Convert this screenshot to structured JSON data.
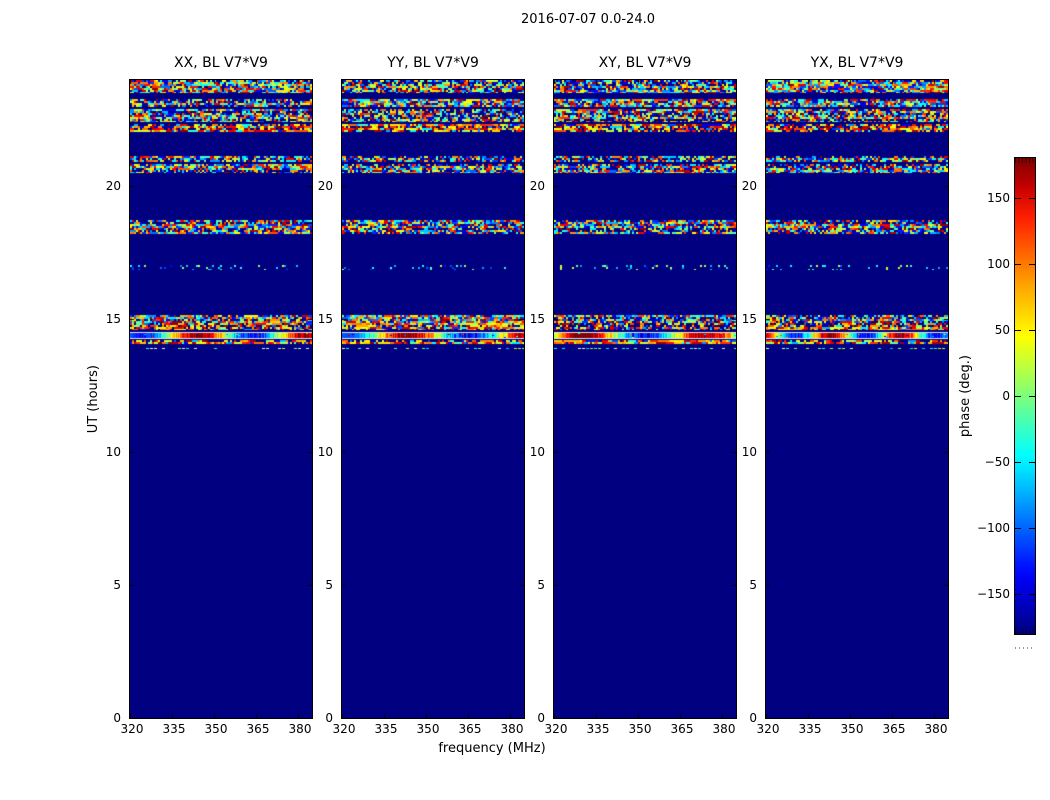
{
  "figure": {
    "title": "2016-07-07 0.0-24.0"
  },
  "chart_data": {
    "type": "heatmap",
    "title": "2016-07-07 0.0-24.0",
    "xlabel": "frequency (MHz)",
    "ylabel": "UT (hours)",
    "xlim": [
      320,
      385
    ],
    "ylim": [
      0,
      24
    ],
    "xticks": [
      320,
      335,
      350,
      365,
      380
    ],
    "yticks": [
      0,
      5,
      10,
      15,
      20
    ],
    "colormap": "jet",
    "background_phase_deg": -180,
    "panels": [
      {
        "label": "XX, BL V7*V9",
        "seed": 101
      },
      {
        "label": "YY, BL V7*V9",
        "seed": 202
      },
      {
        "label": "XY, BL V7*V9",
        "seed": 303
      },
      {
        "label": "YX, BL V7*V9",
        "seed": 404
      }
    ],
    "bands": [
      {
        "ut_from": 23.5,
        "ut_to": 24.0,
        "style": "noise",
        "density": 0.92,
        "note": "thick random-phase band at top"
      },
      {
        "ut_from": 23.0,
        "ut_to": 23.3,
        "style": "noise",
        "density": 0.85,
        "note": "random-phase stripe"
      },
      {
        "ut_from": 22.68,
        "ut_to": 22.9,
        "style": "noise",
        "density": 0.85,
        "note": "random-phase stripe"
      },
      {
        "ut_from": 22.42,
        "ut_to": 22.68,
        "style": "noise",
        "density": 0.8,
        "note": "random-phase stripe"
      },
      {
        "ut_from": 22.04,
        "ut_to": 22.34,
        "style": "noise-warm",
        "density": 0.85,
        "note": "stripe with red/orange excess"
      },
      {
        "ut_from": 20.91,
        "ut_to": 21.14,
        "style": "noise",
        "density": 0.7,
        "note": "thin stripe"
      },
      {
        "ut_from": 20.5,
        "ut_to": 20.84,
        "style": "noise",
        "density": 0.8,
        "note": "double stripe"
      },
      {
        "ut_from": 18.21,
        "ut_to": 18.73,
        "style": "noise",
        "density": 0.9,
        "note": "thick stripe near 18.4h"
      },
      {
        "ut_from": 16.85,
        "ut_to": 17.04,
        "style": "sparse",
        "density": 0.12,
        "note": "very faint sparse stripe"
      },
      {
        "ut_from": 14.86,
        "ut_to": 15.16,
        "style": "noise",
        "density": 0.88,
        "note": "stripe at 15h"
      },
      {
        "ut_from": 14.6,
        "ut_to": 14.86,
        "style": "noise-warm",
        "density": 0.85,
        "note": "stripe with warm streaks"
      },
      {
        "ut_from": 14.26,
        "ut_to": 14.52,
        "style": "smooth",
        "density": 1.0,
        "note": "smooth coherent phase gradient band with pale edges"
      },
      {
        "ut_from": 14.07,
        "ut_to": 14.22,
        "style": "noise-warm",
        "density": 0.85,
        "note": "thin warm stripe"
      },
      {
        "ut_from": 13.84,
        "ut_to": 13.96,
        "style": "dotted",
        "density": 0.3,
        "note": "sparse dashed cyan/white line"
      }
    ],
    "colorbar": {
      "label": "phase (deg.)",
      "range": [
        -180,
        180
      ],
      "ticks": [
        -150,
        -100,
        -50,
        0,
        50,
        100,
        150
      ]
    }
  }
}
